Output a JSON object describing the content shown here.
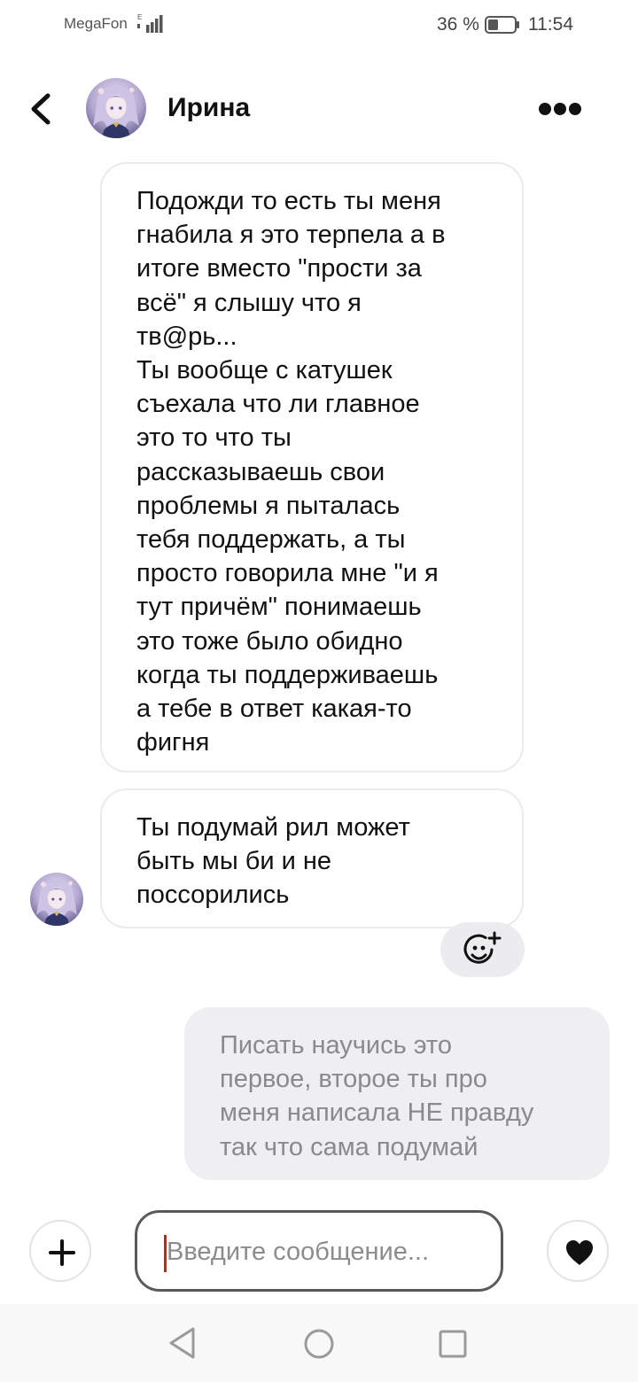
{
  "status_bar": {
    "carrier": "MegaFon",
    "network_type": "E",
    "battery_percent": "36 %",
    "time": "11:54"
  },
  "header": {
    "contact_name": "Ирина",
    "icons": [
      "back-arrow-icon",
      "avatar",
      "more-dots-icon"
    ]
  },
  "messages": [
    {
      "direction": "incoming",
      "text": "Подожди то есть ты меня\nгнабила я это терпела а в\nитоге вместо \"прости за\nвсё\" я слышу что я\nтв@рь...\nТы вообще с катушек\nсъехала что ли главное\nэто то что ты\nрассказываешь свои\nпроблемы я пыталась\nтебя поддержать, а ты\nпросто говорила мне \"и я\nтут причём\" понимаешь\nэто тоже было обидно\nкогда ты поддерживаешь\nа тебе в ответ какая-то\nфигня"
    },
    {
      "direction": "incoming",
      "text": "Ты подумай рил может\nбыть мы би и не\nпоссорились"
    },
    {
      "direction": "outgoing",
      "text": "Писать научись это\nпервое, второе ты про\nменя написала НЕ правду\nтак что сама подумай"
    }
  ],
  "composer": {
    "placeholder": "Введите сообщение..."
  },
  "colors": {
    "incoming_bubble_border": "#ebebeb",
    "outgoing_bubble_bg": "#efeff1",
    "outgoing_text": "#8a8a8e",
    "caret": "#d0201a"
  }
}
